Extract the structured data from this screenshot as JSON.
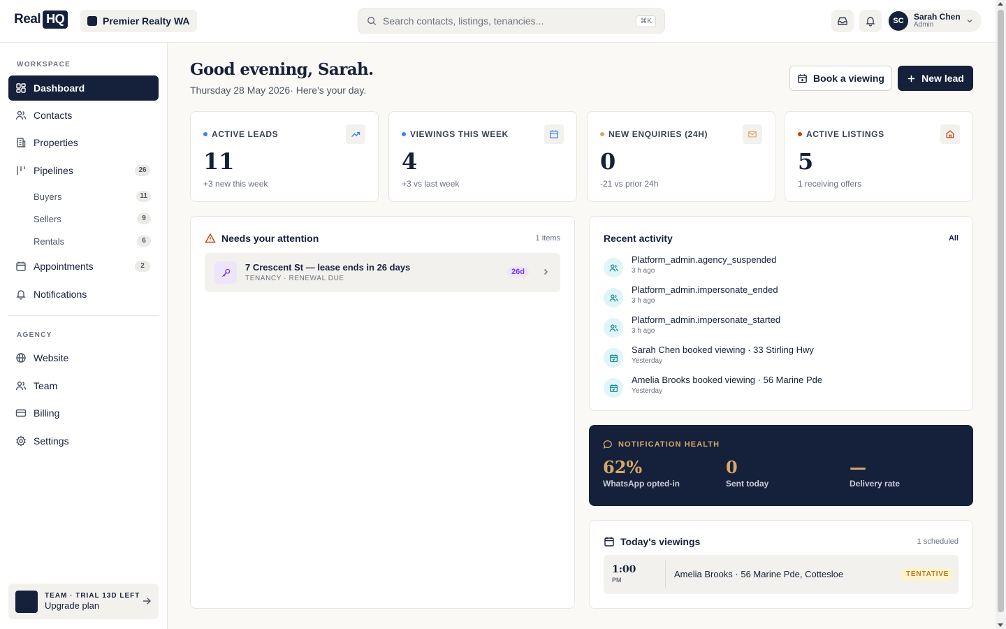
{
  "brand": {
    "logo_word": "Real",
    "logo_badge": "HQ"
  },
  "agency": {
    "name": "Premier Realty WA"
  },
  "search": {
    "placeholder": "Search contacts, listings, tenancies...",
    "shortcut": "⌘K"
  },
  "header_icons": [
    "inbox-icon",
    "bell-icon"
  ],
  "user": {
    "initials": "SC",
    "name": "Sarah Chen",
    "role": "Admin"
  },
  "sidebar": {
    "workspace_label": "WORKSPACE",
    "agency_label": "AGENCY",
    "items": [
      {
        "label": "Dashboard",
        "icon": "dashboard-icon",
        "active": true
      },
      {
        "label": "Contacts",
        "icon": "users-icon"
      },
      {
        "label": "Properties",
        "icon": "building-icon"
      },
      {
        "label": "Pipelines",
        "icon": "pipeline-icon",
        "count": "26"
      },
      {
        "label": "Appointments",
        "icon": "calendar-icon",
        "count": "2"
      },
      {
        "label": "Notifications",
        "icon": "bell-icon"
      }
    ],
    "pipelines": [
      {
        "label": "Buyers",
        "count": "11"
      },
      {
        "label": "Sellers",
        "count": "9"
      },
      {
        "label": "Rentals",
        "count": "6"
      }
    ],
    "agency_items": [
      {
        "label": "Website",
        "icon": "globe-icon"
      },
      {
        "label": "Team",
        "icon": "users-icon"
      },
      {
        "label": "Billing",
        "icon": "credit-card-icon"
      },
      {
        "label": "Settings",
        "icon": "gear-icon"
      }
    ],
    "upgrade": {
      "tag": "TEAM · TRIAL 13D LEFT",
      "label": "Upgrade plan"
    }
  },
  "greeting": {
    "title": "Good evening, Sarah.",
    "subtitle": "Thursday 28 May 2026· Here's your day."
  },
  "actions": {
    "book": "Book a viewing",
    "new_lead": "New lead"
  },
  "stats": [
    {
      "label": "ACTIVE LEADS",
      "value": "11",
      "note": "+3 new this week",
      "dot": "#3b82f6",
      "icon": "trending-up-icon"
    },
    {
      "label": "VIEWINGS THIS WEEK",
      "value": "4",
      "note": "+3 vs last week",
      "dot": "#3b82f6",
      "icon": "calendar-icon"
    },
    {
      "label": "NEW ENQUIRIES (24H)",
      "value": "0",
      "note": "-21 vs prior 24h",
      "dot": "#d9a867",
      "icon": "mail-icon"
    },
    {
      "label": "ACTIVE LISTINGS",
      "value": "5",
      "note": "1 receiving offers",
      "dot": "#c2410c",
      "icon": "home-icon"
    }
  ],
  "attention": {
    "title": "Needs your attention",
    "count": "1 items",
    "items": [
      {
        "title": "7 Crescent St — lease ends in 26 days",
        "subtitle": "TENANCY · RENEWAL DUE",
        "badge": "26d",
        "icon": "key-icon"
      }
    ]
  },
  "activity": {
    "title": "Recent activity",
    "all_label": "All",
    "items": [
      {
        "title": "Platform_admin.agency_suspended",
        "time": "3 h ago",
        "icon": "users-icon"
      },
      {
        "title": "Platform_admin.impersonate_ended",
        "time": "3 h ago",
        "icon": "users-icon"
      },
      {
        "title": "Platform_admin.impersonate_started",
        "time": "3 h ago",
        "icon": "users-icon"
      },
      {
        "title": "Sarah Chen booked viewing · 33 Stirling Hwy",
        "time": "Yesterday",
        "icon": "calendar-icon"
      },
      {
        "title": "Amelia Brooks booked viewing · 56 Marine Pde",
        "time": "Yesterday",
        "icon": "calendar-icon"
      }
    ]
  },
  "notification_health": {
    "label": "NOTIFICATION HEALTH",
    "metrics": [
      {
        "value": "62%",
        "label": "WhatsApp opted-in"
      },
      {
        "value": "0",
        "label": "Sent today"
      },
      {
        "value": "—",
        "label": "Delivery rate"
      }
    ]
  },
  "viewings": {
    "title": "Today's viewings",
    "count": "1 scheduled",
    "items": [
      {
        "time": "1:00",
        "ampm": "PM",
        "text": "Amelia Brooks · 56 Marine Pde, Cottesloe",
        "status": "TENTATIVE"
      }
    ]
  }
}
